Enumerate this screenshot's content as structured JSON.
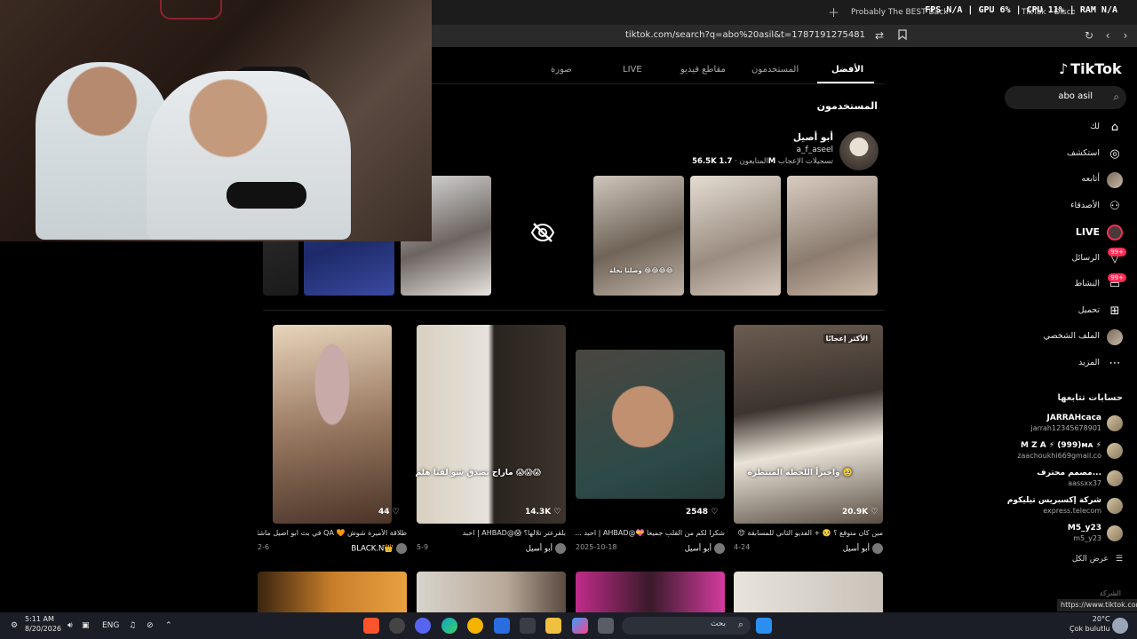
{
  "browser": {
    "tabs": [
      {
        "label": "Probably The BEST Backrooms Game"
      },
      {
        "label": "TikTok - Discover"
      }
    ],
    "overlay_stats": "FPS N/A | GPU 6% | CPU 11% | RAM N/A",
    "url": "tiktok.com/search?q=abo%20asil&t=1787191275481"
  },
  "tiktok": {
    "logo": "TikTok",
    "search_query": "abo asil",
    "nav": [
      {
        "label": "لك",
        "icon": "home-icon"
      },
      {
        "label": "استكشف",
        "icon": "compass-icon"
      },
      {
        "label": "أتابعه",
        "icon": "avatar"
      },
      {
        "label": "الأصدقاء",
        "icon": "friends-icon"
      },
      {
        "label": "LIVE",
        "icon": "live-icon"
      },
      {
        "label": "الرسائل",
        "icon": "messages-icon",
        "badge": "99+"
      },
      {
        "label": "النشاط",
        "icon": "activity-icon",
        "badge": "99+"
      },
      {
        "label": "تحميل",
        "icon": "upload-icon"
      },
      {
        "label": "الملف الشخصي",
        "icon": "avatar"
      },
      {
        "label": "المزيد",
        "icon": "more-icon"
      }
    ],
    "following_title": "حسابات تتابعها",
    "following": [
      {
        "name": "JARRAHcaca",
        "handle": "jarrah12345678901"
      },
      {
        "name": "M Z A ⚡ (999)ᴍᴀ ⚡",
        "handle": "zaachoukhi669gmail.co"
      },
      {
        "name": "مصمم محترف...",
        "handle": "aassxx37"
      },
      {
        "name": "شركة إكسبريس تيليكوم",
        "handle": "express.telecom"
      },
      {
        "name": "M5_y23",
        "handle": "m5_y23"
      }
    ],
    "see_all": "عرض الكل",
    "footer": "الشركة",
    "status_link": "https://www.tiktok.com"
  },
  "search_tabs": {
    "best": "الأفضل",
    "users": "المستخدمون",
    "videos": "مقاطع فيديو",
    "live": "LIVE",
    "photo": "صورة"
  },
  "users_section": {
    "title": "المستخدمون",
    "name": "أبو أصيل",
    "handle": "a_f_aseel",
    "followers_value": "56.5K",
    "followers_label": "المتابعون",
    "likes_value": "1.7M",
    "likes_label": "تسجيلات الإعجاب",
    "thumb_caption": "وصلنا بخلة 😂😂😂😂"
  },
  "videos": [
    {
      "likes": "20.9K",
      "badge": "الأكثر إعجابًا",
      "overlay": "واخيراً اللحظة المنتظرة 🥹",
      "desc": "مين كان متوقع ؟ 🥺 + الفديو الثاني للمسابقة 😍",
      "author": "أبو أسيل",
      "date": "4-24"
    },
    {
      "likes": "2548",
      "badge": "",
      "overlay": "",
      "desc": "شكراً لكم من القلب جميعاً 💝@AHBAD | احبد ...",
      "author": "أبو أسيل",
      "date": "2025-10-18"
    },
    {
      "likes": "14.3K",
      "badge": "",
      "overlay": "ماراح تصدق شو لقنا هلم 😱😱😱",
      "desc": "بلقرعتر تلالها؟ 😱@AHBAD | احبد",
      "author": "أبو أسيل",
      "date": "5-9"
    },
    {
      "likes": "44",
      "badge": "",
      "overlay": "",
      "desc": "طلاقة الأميرة شوش 🧡 QA في بث ابو اصيل ماشاء...",
      "author": "BLACK.N👑",
      "date": "2-6"
    }
  ],
  "taskbar": {
    "time": "5:11 AM",
    "date": "8/20/2026",
    "lang": "ENG",
    "search": "بحث",
    "weather_temp": "20°C",
    "weather_desc": "Çok bulutlu"
  }
}
